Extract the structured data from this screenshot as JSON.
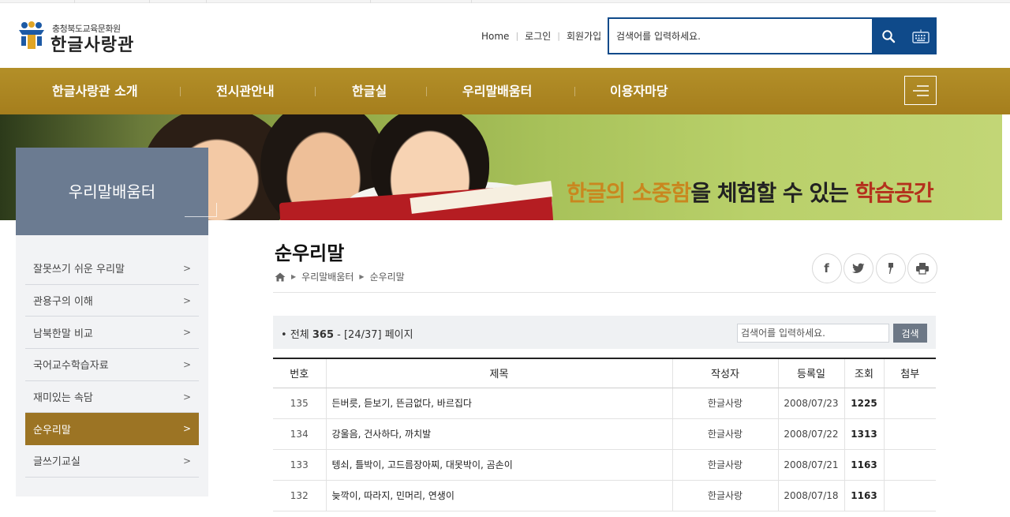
{
  "logo": {
    "subtitle": "충청북도교육문화원",
    "name": "한글사랑관"
  },
  "util_links": [
    "Home",
    "로그인",
    "회원가입"
  ],
  "search": {
    "placeholder": "검색어를 입력하세요."
  },
  "nav": {
    "items": [
      "한글사랑관 소개",
      "전시관안내",
      "한글실",
      "우리말배움터",
      "이용자마당"
    ]
  },
  "banner": {
    "slogan_part1": "한글의 소중함",
    "slogan_part2": "을 체험할 수 있는 ",
    "slogan_part3": "학습공간"
  },
  "sidebar": {
    "title": "우리말배움터",
    "items": [
      {
        "label": "잘못쓰기 쉬운 우리말",
        "active": false
      },
      {
        "label": "관용구의 이해",
        "active": false
      },
      {
        "label": "남북한말 비교",
        "active": false
      },
      {
        "label": "국어교수학습자료",
        "active": false
      },
      {
        "label": "재미있는 속담",
        "active": false
      },
      {
        "label": "순우리말",
        "active": true
      },
      {
        "label": "글쓰기교실",
        "active": false
      }
    ]
  },
  "page": {
    "title": "순우리말",
    "breadcrumb": [
      "우리말배움터",
      "순우리말"
    ]
  },
  "share_icons": [
    "facebook-icon",
    "twitter-icon",
    "kakao-story-icon",
    "print-icon"
  ],
  "list": {
    "total_label": "전체",
    "total_count": "365",
    "page_info": "[24/37] 페이지",
    "search_placeholder": "검색어를 입력하세요.",
    "search_button": "검색",
    "columns": [
      "번호",
      "제목",
      "작성자",
      "등록일",
      "조회",
      "첨부"
    ],
    "rows": [
      {
        "no": "135",
        "title": "든버릇, 듣보기, 뜬금없다, 바르집다",
        "author": "한글사랑",
        "date": "2008/07/23",
        "views": "1225",
        "attach": ""
      },
      {
        "no": "134",
        "title": "강울음, 건사하다, 까치발",
        "author": "한글사랑",
        "date": "2008/07/22",
        "views": "1313",
        "attach": ""
      },
      {
        "no": "133",
        "title": "텡쇠, 틀박이, 고드름장아찌, 대못박이, 곰손이",
        "author": "한글사랑",
        "date": "2008/07/21",
        "views": "1163",
        "attach": ""
      },
      {
        "no": "132",
        "title": "늦깍이, 따라지, 민머리, 연생이",
        "author": "한글사랑",
        "date": "2008/07/18",
        "views": "1163",
        "attach": ""
      }
    ]
  },
  "colors": {
    "nav_gold": "#a98422",
    "sidebar_slate": "#6b7b91",
    "active_gold": "#9c7424",
    "search_blue": "#0f4a8a"
  }
}
